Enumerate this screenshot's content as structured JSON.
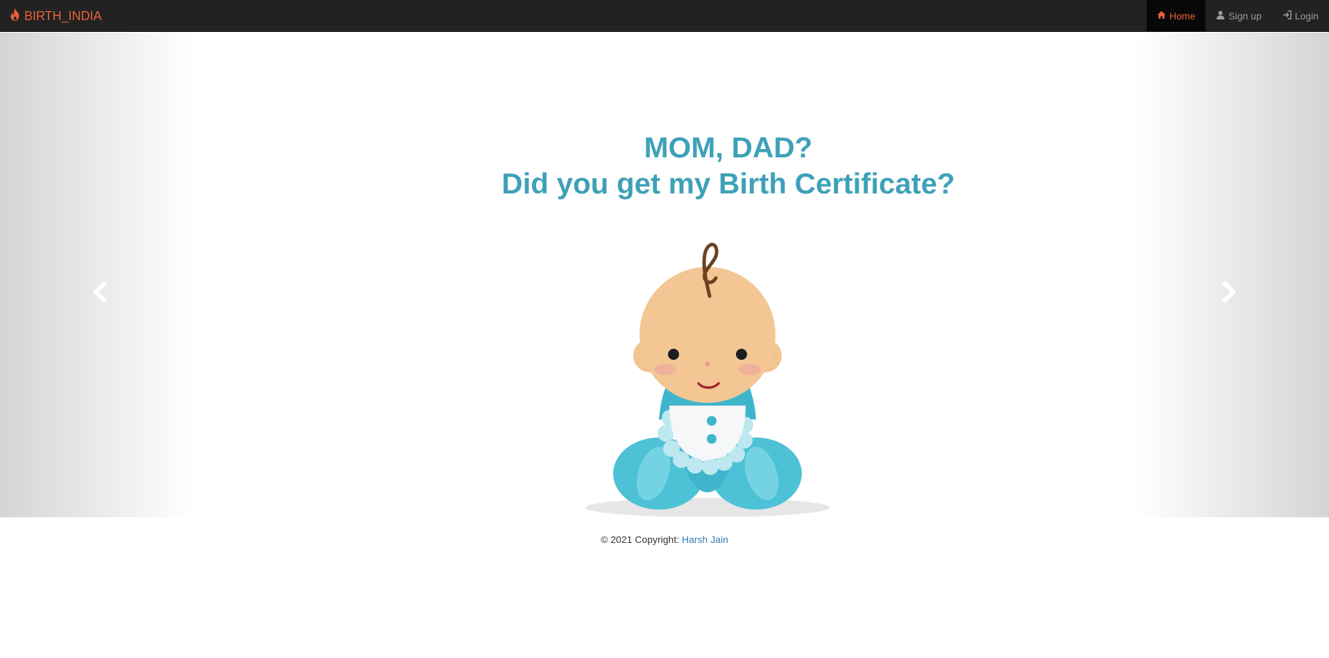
{
  "navbar": {
    "brand": "BIRTH_INDIA",
    "brand_icon": "fire-icon",
    "items": [
      {
        "label": "Home",
        "icon": "home-icon",
        "active": true
      },
      {
        "label": "Sign up",
        "icon": "user-icon",
        "active": false
      },
      {
        "label": "Login",
        "icon": "login-icon",
        "active": false
      }
    ]
  },
  "carousel": {
    "headline_line1": "MOM, DAD?",
    "headline_line2": "Did you get my Birth Certificate?",
    "prev_icon": "chevron-left-icon",
    "next_icon": "chevron-right-icon"
  },
  "footer": {
    "copyright": "© 2021 Copyright:",
    "author": "Harsh Jain"
  },
  "colors": {
    "navbar_bg": "#222222",
    "brand": "#e8613c",
    "headline": "#3ea1b8",
    "link": "#337ab7"
  }
}
